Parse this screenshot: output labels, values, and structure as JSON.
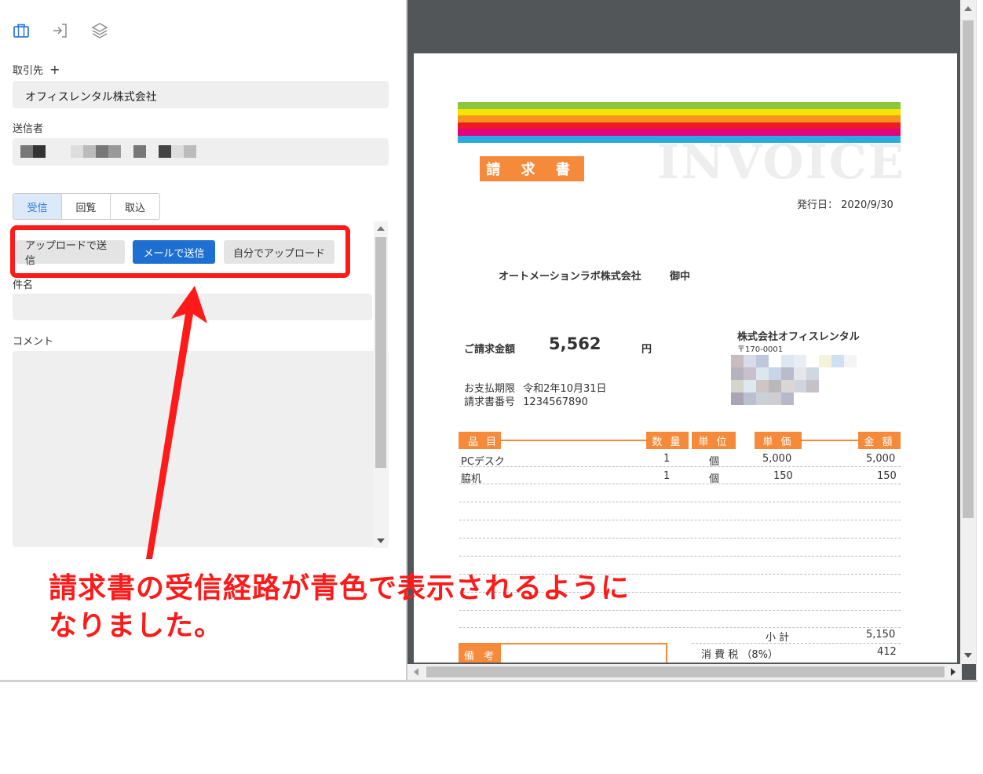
{
  "left_panel": {
    "toolbar_icons": [
      "briefcase-icon",
      "sign-in-icon",
      "layers-icon"
    ],
    "torihikisaki_label": "取引先",
    "torihikisaki_add": "+",
    "torihikisaki_value": "オフィスレンタル株式会社",
    "sender_label": "送信者",
    "tabs": [
      {
        "label": "受信",
        "active": true
      },
      {
        "label": "回覧",
        "active": false
      },
      {
        "label": "取込",
        "active": false
      }
    ],
    "buttons": {
      "upload_send": "アップロードで送信",
      "mail_send": "メールで送信",
      "self_upload": "自分でアップロード"
    },
    "subject_label": "件名",
    "comment_label": "コメント"
  },
  "annotation": {
    "line1": "請求書の受信経路が青色で表示されるように",
    "line2": "なりました。",
    "color": "#ff1a1a"
  },
  "invoice": {
    "title": "請 求 書",
    "watermark": "INVOICE",
    "issue_date_label": "発行日：",
    "issue_date": "2020/9/30",
    "recipient": "オートメーションラボ株式会社",
    "recipient_suffix": "御中",
    "amount_label": "ご請求金額",
    "amount": "5,562",
    "amount_unit": "円",
    "issuer": "株式会社オフィスレンタル",
    "issuer_zip": "〒170-0001",
    "due_label": "お支払期限",
    "due_value": "令和2年10月31日",
    "number_label": "請求書番号",
    "number_value": "1234567890",
    "columns": [
      "品 目",
      "数 量",
      "単 位",
      "単 価",
      "金 額"
    ],
    "rows": [
      {
        "item": "PCデスク",
        "qty": "1",
        "unit": "個",
        "price": "5,000",
        "amount": "5,000"
      },
      {
        "item": "脇机",
        "qty": "1",
        "unit": "個",
        "price": "150",
        "amount": "150"
      }
    ],
    "subtotal_label": "小 計",
    "subtotal": "5,150",
    "tax_label": "消 費 税 （8%）",
    "tax": "412",
    "remarks_label": "備 考",
    "accent": "#f58b3a"
  }
}
